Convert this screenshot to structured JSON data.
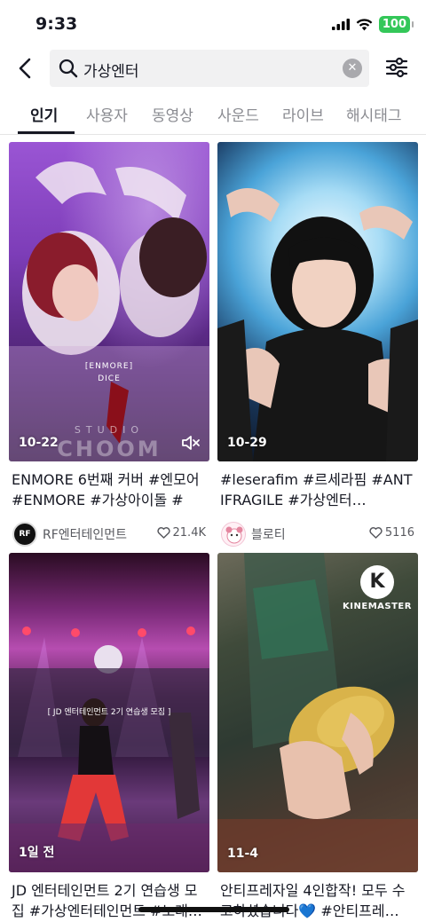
{
  "status_bar": {
    "time": "9:33",
    "battery": "100"
  },
  "search": {
    "query": "가상엔터"
  },
  "tabs": [
    {
      "label": "인기"
    },
    {
      "label": "사용자"
    },
    {
      "label": "동영상"
    },
    {
      "label": "사운드"
    },
    {
      "label": "라이브"
    },
    {
      "label": "해시태그"
    }
  ],
  "active_tab": "인기",
  "videos": [
    {
      "date": "10-22",
      "overlay_line1": "[ENMORE]",
      "overlay_line2": "DICE",
      "overlay_watermark": "STUDIO",
      "overlay_watermark2": "CHOOM",
      "caption": "ENMORE 6번째 커버 #엔모어 #ENMORE #가상아이돌 #가…",
      "user": "RF엔터테인먼트",
      "avatar_text": "RF",
      "likes": "21.4K"
    },
    {
      "date": "10-29",
      "caption": "#leserafim #르세라핌 #ANTIFRAGILE #가상엔터…",
      "user": "블로티",
      "likes": "5116"
    },
    {
      "date": "1일 전",
      "overlay_banner": "[ JD 엔터테인먼트 2기 연습생 모집 ]",
      "caption": "JD 엔터테인먼트 2기 연습생 모집 #가상엔터테인먼트 #노래…"
    },
    {
      "date": "11-4",
      "overlay_watermark": "KINEMASTER",
      "caption": "안티프레자일 4인합작! 모두 수고하셨습니다💙 #안티프레…"
    }
  ],
  "colors": {
    "accent": "#161823",
    "battery": "#34c759",
    "secondary_text": "#8a8b91"
  }
}
